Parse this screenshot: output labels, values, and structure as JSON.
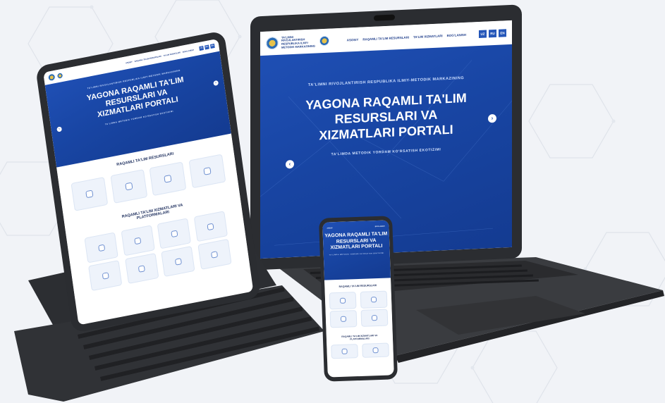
{
  "portal": {
    "org_name": "TA'LIMNI RIVOJLANTIRISH RESPUBLIKA ILMIY-METODIK MARKAZINING",
    "title_line1": "YAGONA RAQAMLI TA'LIM",
    "title_line2": "RESURSLARI VA",
    "title_line3": "XIZMATLARI PORTALI",
    "tagline": "TA'LIMDA METODIK YORDAM KO'RSATISH EKOTIZIMI"
  },
  "nav": {
    "items": [
      "ASOSIY",
      "RAQAMLI TA'LIM RESURSLARI",
      "TA'LIM XIZMATLARI",
      "BOG'LANISH"
    ],
    "languages": [
      "UZ",
      "RU",
      "EN"
    ]
  },
  "sections": {
    "resources_title": "RAQAMLI TA'LIM RESURSLARI",
    "services_title_line1": "RAQAMLI TA'LIM XIZMATLARI VA",
    "services_title_line2": "PLATFORMALARI"
  },
  "colors": {
    "brand_blue": "#1f4fb4",
    "background": "#f1f3f7",
    "device_frame": "#2b2d31",
    "card_bg": "#eef3fb"
  }
}
